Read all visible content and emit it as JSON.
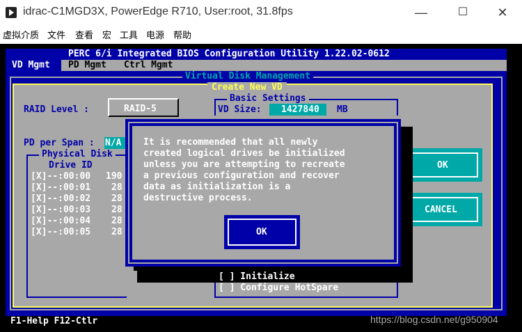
{
  "window": {
    "title": "idrac-C1MGD3X, PowerEdge R710, User:root, 31.8fps",
    "minimize": "—",
    "maximize": "☐",
    "close": "✕"
  },
  "menu": [
    "虚拟介质",
    "文件",
    "查看",
    "宏",
    "工具",
    "电源",
    "帮助"
  ],
  "bios": {
    "header": "PERC 6/i Integrated BIOS Configuration Utility 1.22.02-0612",
    "tabs": [
      "VD Mgmt",
      "PD Mgmt",
      "Ctrl Mgmt"
    ],
    "vdm_title": "Virtual Disk Management",
    "create_title": "Create New VD",
    "raid_level_label": "RAID Level :",
    "raid_level_value": "RAID-5",
    "basic_settings": "Basic Settings",
    "vd_size_label": "VD Size:",
    "vd_size_value": "1427840",
    "vd_size_unit": "MB",
    "pd_per_span_label": "PD per Span :",
    "pd_per_span_value": "N/A",
    "physical_disk_title": "Physical Disk",
    "drive_id_header": "Drive ID",
    "drives": [
      {
        "id": "[X]--:00:00",
        "size": "190"
      },
      {
        "id": "[X]--:00:01",
        "size": "28"
      },
      {
        "id": "[X]--:00:02",
        "size": "28"
      },
      {
        "id": "[X]--:00:03",
        "size": "28"
      },
      {
        "id": "[X]--:00:04",
        "size": "28"
      },
      {
        "id": "[X]--:00:05",
        "size": "28"
      }
    ],
    "ok_button": "OK",
    "cancel_button": "CANCEL",
    "initialize": "[ ] Initialize",
    "configure_hotspare": "[ ] Configure HotSpare",
    "footer": "F1-Help F12-Ctlr",
    "watermark": "https://blog.csdn.net/g950904"
  },
  "dialog": {
    "lines": [
      "It is recommended that all newly",
      "created logical drives be initialized",
      "unless you are attempting to recreate",
      "a previous configuration and recover",
      "data as initialization is a",
      "destructive process."
    ],
    "ok_button": "OK"
  },
  "colors": {
    "bios_blue": "#0000a8",
    "bios_gray": "#a8a8a8",
    "bios_cyan": "#00a8a8",
    "bios_yellow": "#ffff54",
    "bios_white": "#ffffff"
  }
}
